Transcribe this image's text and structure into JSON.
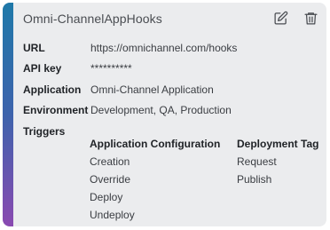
{
  "card": {
    "title": "Omni-ChannelAppHooks",
    "icons": {
      "edit": "edit-icon",
      "delete": "trash-icon"
    },
    "accent_colors": [
      "#1f79a9",
      "#3d63ac",
      "#8a4ab1"
    ]
  },
  "fields": {
    "url": {
      "label": "URL",
      "value": "https://omnichannel.com/hooks"
    },
    "api_key": {
      "label": "API key",
      "value": "**********"
    },
    "application": {
      "label": "Application",
      "value": "Omni-Channel Application"
    },
    "environment": {
      "label": "Environment",
      "value": "Development, QA, Production"
    },
    "triggers": {
      "label": "Triggers"
    }
  },
  "triggers": {
    "columns": [
      {
        "header": "Application Configuration",
        "items": [
          "Creation",
          "Override",
          "Deploy",
          "Undeploy"
        ]
      },
      {
        "header": "Deployment Tag",
        "items": [
          "Request",
          "Publish"
        ]
      }
    ]
  }
}
